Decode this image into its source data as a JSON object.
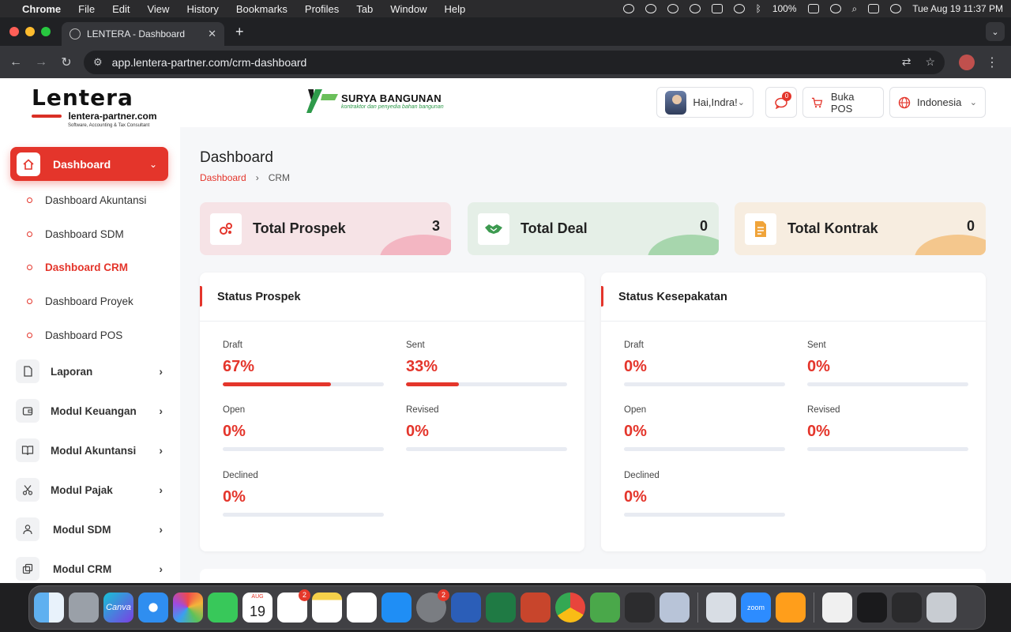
{
  "menubar": {
    "app": "Chrome",
    "items": [
      "File",
      "Edit",
      "View",
      "History",
      "Bookmarks",
      "Profiles",
      "Tab",
      "Window",
      "Help"
    ],
    "battery": "100%",
    "clock": "Tue Aug 19  11:37 PM"
  },
  "browser": {
    "tab_title": "LENTERA - Dashboard",
    "url": "app.lentera-partner.com/crm-dashboard"
  },
  "sidebar": {
    "logo_title": "Lentera",
    "logo_site": "lentera-partner.com",
    "logo_tagline": "Software, Accounting & Tax Consultant",
    "active_item": "Dashboard",
    "sub_items": [
      "Dashboard Akuntansi",
      "Dashboard SDM",
      "Dashboard CRM",
      "Dashboard Proyek",
      "Dashboard POS"
    ],
    "items": [
      "Laporan",
      "Modul Keuangan",
      "Modul Akuntansi",
      "Modul Pajak",
      "Modul SDM",
      "Modul CRM"
    ]
  },
  "header": {
    "brand_name": "SURYA BANGUNAN",
    "brand_tagline": "kontraktor dan penyedia bahan bangunan",
    "greeting": "Hai,Indra!",
    "notif_count": "0",
    "pos_button": "Buka POS",
    "language": "Indonesia"
  },
  "page": {
    "title": "Dashboard",
    "breadcrumb": [
      "Dashboard",
      "CRM"
    ]
  },
  "stats": [
    {
      "label": "Total Prospek",
      "value": "3",
      "color": "#f6e3e6",
      "wave": "#f3b6c2"
    },
    {
      "label": "Total Deal",
      "value": "0",
      "color": "#e5efe7",
      "wave": "#a7d6ad"
    },
    {
      "label": "Total Kontrak",
      "value": "0",
      "color": "#f7ede0",
      "wave": "#f4c78d"
    }
  ],
  "status_prospek": {
    "title": "Status Prospek",
    "metrics": [
      {
        "label": "Draft",
        "value": "67%",
        "fraction": 0.67
      },
      {
        "label": "Sent",
        "value": "33%",
        "fraction": 0.33
      },
      {
        "label": "Open",
        "value": "0%",
        "fraction": 0
      },
      {
        "label": "Revised",
        "value": "0%",
        "fraction": 0
      },
      {
        "label": "Declined",
        "value": "0%",
        "fraction": 0
      }
    ]
  },
  "status_kesepakatan": {
    "title": "Status Kesepakatan",
    "metrics": [
      {
        "label": "Draft",
        "value": "0%",
        "fraction": 0
      },
      {
        "label": "Sent",
        "value": "0%",
        "fraction": 0
      },
      {
        "label": "Open",
        "value": "0%",
        "fraction": 0
      },
      {
        "label": "Revised",
        "value": "0%",
        "fraction": 0
      },
      {
        "label": "Declined",
        "value": "0%",
        "fraction": 0
      }
    ]
  },
  "dock": {
    "calendar_month": "AUG",
    "calendar_day": "19",
    "reminders_badge": "2",
    "settings_badge": "2",
    "zoom_label": "zoom",
    "canva_label": "Canva"
  },
  "colors": {
    "accent": "#e4352b"
  }
}
